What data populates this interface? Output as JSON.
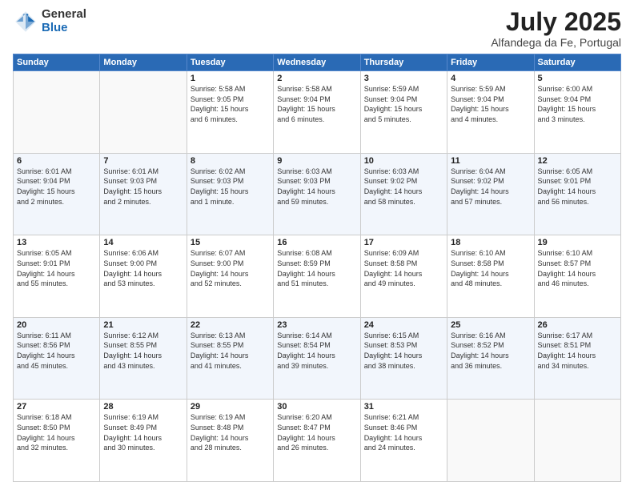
{
  "header": {
    "logo_general": "General",
    "logo_blue": "Blue",
    "month_title": "July 2025",
    "location": "Alfandega da Fe, Portugal"
  },
  "days_of_week": [
    "Sunday",
    "Monday",
    "Tuesday",
    "Wednesday",
    "Thursday",
    "Friday",
    "Saturday"
  ],
  "weeks": [
    [
      {
        "day": "",
        "detail": ""
      },
      {
        "day": "",
        "detail": ""
      },
      {
        "day": "1",
        "detail": "Sunrise: 5:58 AM\nSunset: 9:05 PM\nDaylight: 15 hours\nand 6 minutes."
      },
      {
        "day": "2",
        "detail": "Sunrise: 5:58 AM\nSunset: 9:04 PM\nDaylight: 15 hours\nand 6 minutes."
      },
      {
        "day": "3",
        "detail": "Sunrise: 5:59 AM\nSunset: 9:04 PM\nDaylight: 15 hours\nand 5 minutes."
      },
      {
        "day": "4",
        "detail": "Sunrise: 5:59 AM\nSunset: 9:04 PM\nDaylight: 15 hours\nand 4 minutes."
      },
      {
        "day": "5",
        "detail": "Sunrise: 6:00 AM\nSunset: 9:04 PM\nDaylight: 15 hours\nand 3 minutes."
      }
    ],
    [
      {
        "day": "6",
        "detail": "Sunrise: 6:01 AM\nSunset: 9:04 PM\nDaylight: 15 hours\nand 2 minutes."
      },
      {
        "day": "7",
        "detail": "Sunrise: 6:01 AM\nSunset: 9:03 PM\nDaylight: 15 hours\nand 2 minutes."
      },
      {
        "day": "8",
        "detail": "Sunrise: 6:02 AM\nSunset: 9:03 PM\nDaylight: 15 hours\nand 1 minute."
      },
      {
        "day": "9",
        "detail": "Sunrise: 6:03 AM\nSunset: 9:03 PM\nDaylight: 14 hours\nand 59 minutes."
      },
      {
        "day": "10",
        "detail": "Sunrise: 6:03 AM\nSunset: 9:02 PM\nDaylight: 14 hours\nand 58 minutes."
      },
      {
        "day": "11",
        "detail": "Sunrise: 6:04 AM\nSunset: 9:02 PM\nDaylight: 14 hours\nand 57 minutes."
      },
      {
        "day": "12",
        "detail": "Sunrise: 6:05 AM\nSunset: 9:01 PM\nDaylight: 14 hours\nand 56 minutes."
      }
    ],
    [
      {
        "day": "13",
        "detail": "Sunrise: 6:05 AM\nSunset: 9:01 PM\nDaylight: 14 hours\nand 55 minutes."
      },
      {
        "day": "14",
        "detail": "Sunrise: 6:06 AM\nSunset: 9:00 PM\nDaylight: 14 hours\nand 53 minutes."
      },
      {
        "day": "15",
        "detail": "Sunrise: 6:07 AM\nSunset: 9:00 PM\nDaylight: 14 hours\nand 52 minutes."
      },
      {
        "day": "16",
        "detail": "Sunrise: 6:08 AM\nSunset: 8:59 PM\nDaylight: 14 hours\nand 51 minutes."
      },
      {
        "day": "17",
        "detail": "Sunrise: 6:09 AM\nSunset: 8:58 PM\nDaylight: 14 hours\nand 49 minutes."
      },
      {
        "day": "18",
        "detail": "Sunrise: 6:10 AM\nSunset: 8:58 PM\nDaylight: 14 hours\nand 48 minutes."
      },
      {
        "day": "19",
        "detail": "Sunrise: 6:10 AM\nSunset: 8:57 PM\nDaylight: 14 hours\nand 46 minutes."
      }
    ],
    [
      {
        "day": "20",
        "detail": "Sunrise: 6:11 AM\nSunset: 8:56 PM\nDaylight: 14 hours\nand 45 minutes."
      },
      {
        "day": "21",
        "detail": "Sunrise: 6:12 AM\nSunset: 8:55 PM\nDaylight: 14 hours\nand 43 minutes."
      },
      {
        "day": "22",
        "detail": "Sunrise: 6:13 AM\nSunset: 8:55 PM\nDaylight: 14 hours\nand 41 minutes."
      },
      {
        "day": "23",
        "detail": "Sunrise: 6:14 AM\nSunset: 8:54 PM\nDaylight: 14 hours\nand 39 minutes."
      },
      {
        "day": "24",
        "detail": "Sunrise: 6:15 AM\nSunset: 8:53 PM\nDaylight: 14 hours\nand 38 minutes."
      },
      {
        "day": "25",
        "detail": "Sunrise: 6:16 AM\nSunset: 8:52 PM\nDaylight: 14 hours\nand 36 minutes."
      },
      {
        "day": "26",
        "detail": "Sunrise: 6:17 AM\nSunset: 8:51 PM\nDaylight: 14 hours\nand 34 minutes."
      }
    ],
    [
      {
        "day": "27",
        "detail": "Sunrise: 6:18 AM\nSunset: 8:50 PM\nDaylight: 14 hours\nand 32 minutes."
      },
      {
        "day": "28",
        "detail": "Sunrise: 6:19 AM\nSunset: 8:49 PM\nDaylight: 14 hours\nand 30 minutes."
      },
      {
        "day": "29",
        "detail": "Sunrise: 6:19 AM\nSunset: 8:48 PM\nDaylight: 14 hours\nand 28 minutes."
      },
      {
        "day": "30",
        "detail": "Sunrise: 6:20 AM\nSunset: 8:47 PM\nDaylight: 14 hours\nand 26 minutes."
      },
      {
        "day": "31",
        "detail": "Sunrise: 6:21 AM\nSunset: 8:46 PM\nDaylight: 14 hours\nand 24 minutes."
      },
      {
        "day": "",
        "detail": ""
      },
      {
        "day": "",
        "detail": ""
      }
    ]
  ]
}
